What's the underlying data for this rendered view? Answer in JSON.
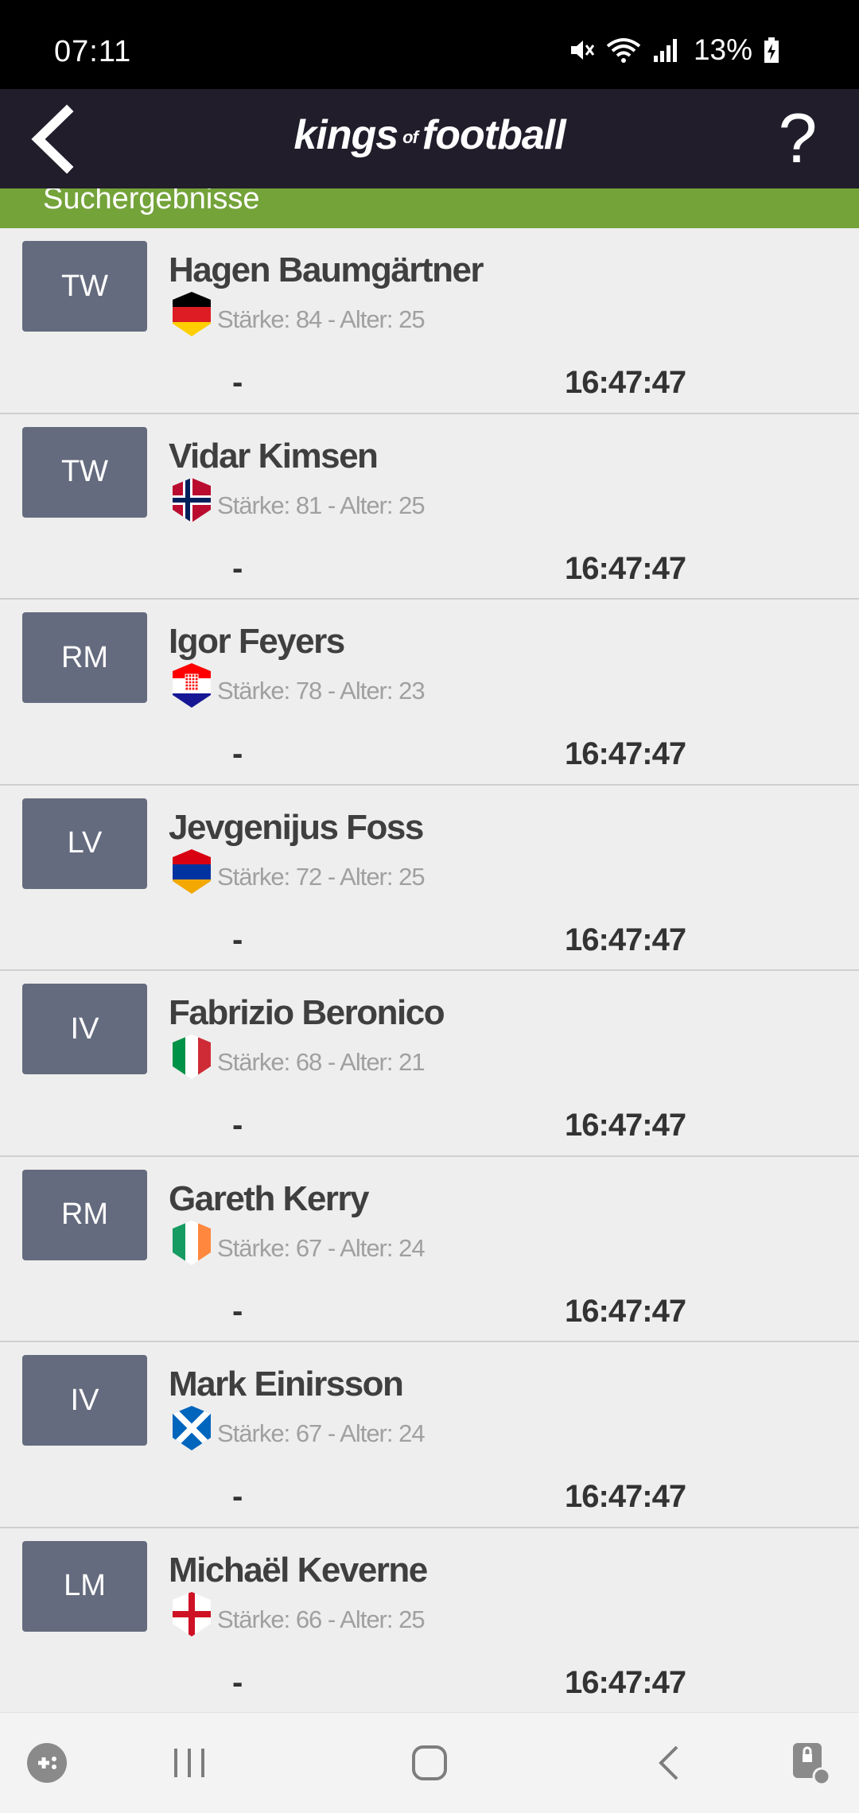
{
  "status_bar": {
    "time": "07:11",
    "battery": "13%",
    "icons": [
      "mute-icon",
      "wifi-icon",
      "signal-icon",
      "battery-charging-icon"
    ]
  },
  "header": {
    "logo_kings": "kings",
    "logo_of": "of",
    "logo_football": "football",
    "help_label": "?"
  },
  "section": {
    "title": "Suchergebnisse"
  },
  "colors": {
    "header_bg": "#211d2b",
    "section_bg": "#74a33a",
    "badge_bg": "#656b7e"
  },
  "players": [
    {
      "position": "TW",
      "name": "Hagen Baumgärtner",
      "flag": "germany",
      "stats": "Stärke: 84 - Alter: 25",
      "dash": "-",
      "time": "16:47:47"
    },
    {
      "position": "TW",
      "name": "Vidar Kimsen",
      "flag": "norway",
      "stats": "Stärke: 81 - Alter: 25",
      "dash": "-",
      "time": "16:47:47"
    },
    {
      "position": "RM",
      "name": "Igor Feyers",
      "flag": "croatia",
      "stats": "Stärke: 78 - Alter: 23",
      "dash": "-",
      "time": "16:47:47"
    },
    {
      "position": "LV",
      "name": "Jevgenijus Foss",
      "flag": "armenia",
      "stats": "Stärke: 72 - Alter: 25",
      "dash": "-",
      "time": "16:47:47"
    },
    {
      "position": "IV",
      "name": "Fabrizio Beronico",
      "flag": "italy",
      "stats": "Stärke: 68 - Alter: 21",
      "dash": "-",
      "time": "16:47:47"
    },
    {
      "position": "RM",
      "name": "Gareth Kerry",
      "flag": "ireland",
      "stats": "Stärke: 67 - Alter: 24",
      "dash": "-",
      "time": "16:47:47"
    },
    {
      "position": "IV",
      "name": "Mark Einirsson",
      "flag": "scotland",
      "stats": "Stärke: 67 - Alter: 24",
      "dash": "-",
      "time": "16:47:47"
    },
    {
      "position": "LM",
      "name": "Michaël Keverne",
      "flag": "england",
      "stats": "Stärke: 66 - Alter: 25",
      "dash": "-",
      "time": "16:47:47"
    }
  ],
  "nav_bar": {
    "icons": [
      "game-launcher-icon",
      "recent-apps-icon",
      "home-icon",
      "back-icon",
      "screen-lock-icon"
    ]
  }
}
